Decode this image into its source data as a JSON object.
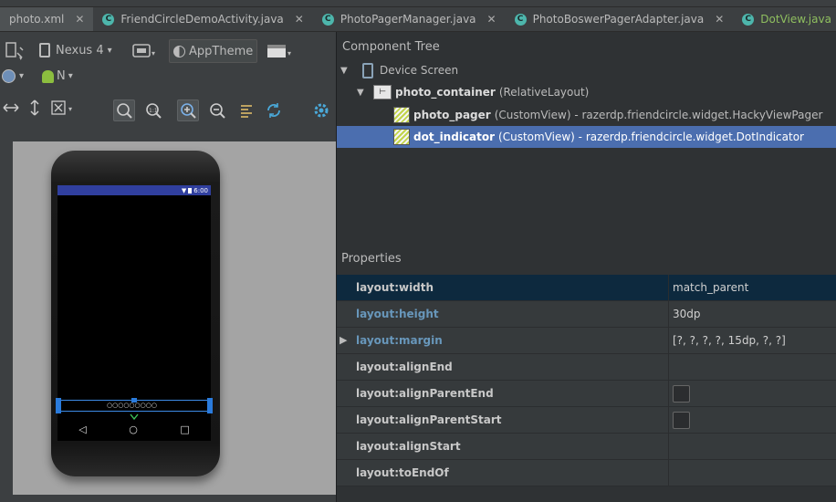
{
  "tabs": [
    {
      "label": "photo.xml",
      "icon": "xml-layout-icon",
      "active": true
    },
    {
      "label": "FriendCircleDemoActivity.java",
      "icon": "class-icon"
    },
    {
      "label": "PhotoPagerManager.java",
      "icon": "class-icon"
    },
    {
      "label": "PhotoBoswerPagerAdapter.java",
      "icon": "class-icon"
    },
    {
      "label": "DotView.java",
      "icon": "class-icon",
      "color": "#8fbf5f"
    }
  ],
  "tab_close": "✕",
  "tab_class_glyph": "C",
  "toolbar": {
    "device": "Nexus 4",
    "theme": "AppTheme",
    "api": "N",
    "dropdown": "▾"
  },
  "device_preview": {
    "status_time": "6:00",
    "status_bg": "#303f9f",
    "nav_back": "◁",
    "nav_home": "○",
    "nav_recent": "□",
    "dot_indicator": "○○○○○○○○○"
  },
  "component_tree": {
    "title": "Component Tree",
    "items": [
      {
        "name": "Device Screen",
        "type": "",
        "expanded": true
      },
      {
        "name": "photo_container",
        "type": "(RelativeLayout)",
        "expanded": true
      },
      {
        "name": "photo_pager",
        "type": "(CustomView) - razerdp.friendcircle.widget.HackyViewPager"
      },
      {
        "name": "dot_indicator",
        "type": "(CustomView) - razerdp.friendcircle.widget.DotIndicator",
        "selected": true
      }
    ]
  },
  "properties": {
    "title": "Properties",
    "rows": [
      {
        "name": "layout:width",
        "value": "match_parent",
        "highlight": true
      },
      {
        "name": "layout:height",
        "value": "30dp",
        "modified": true
      },
      {
        "name": "layout:margin",
        "value": "[?, ?, ?, ?, 15dp, ?, ?]",
        "modified": true,
        "expandable": true
      },
      {
        "name": "layout:alignEnd",
        "value": ""
      },
      {
        "name": "layout:alignParentEnd",
        "value": "",
        "checkbox": true
      },
      {
        "name": "layout:alignParentStart",
        "value": "",
        "checkbox": true
      },
      {
        "name": "layout:alignStart",
        "value": ""
      },
      {
        "name": "layout:toEndOf",
        "value": ""
      }
    ]
  },
  "colors": {
    "selection": "#4b6eaf",
    "accent_blue": "#3d8be6",
    "modified_prop": "#6897bb"
  }
}
